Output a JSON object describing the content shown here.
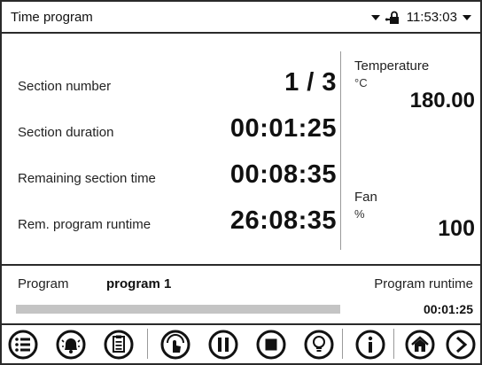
{
  "header": {
    "title": "Time program",
    "clock": "11:53:03"
  },
  "sections": {
    "section_number": {
      "label": "Section number",
      "value": "1 / 3"
    },
    "section_duration": {
      "label": "Section duration",
      "value": "00:01:25"
    },
    "remaining_section_time": {
      "label": "Remaining section time",
      "value": "00:08:35"
    },
    "rem_program_runtime": {
      "label": "Rem. program runtime",
      "value": "26:08:35"
    }
  },
  "temperature": {
    "label": "Temperature",
    "unit": "°C",
    "value": "180.00"
  },
  "fan": {
    "label": "Fan",
    "unit": "%",
    "value": "100"
  },
  "program": {
    "label": "Program",
    "name": "program 1",
    "runtime_label": "Program runtime",
    "runtime_value": "00:01:25",
    "progress_fraction": 0.0
  },
  "toolbar": {
    "buttons": [
      "list-icon",
      "alarm-bell-icon",
      "clipboard-icon",
      "manual-mode-icon",
      "pause-icon",
      "stop-icon",
      "light-bulb-icon",
      "info-icon",
      "home-icon",
      "next-icon"
    ]
  }
}
